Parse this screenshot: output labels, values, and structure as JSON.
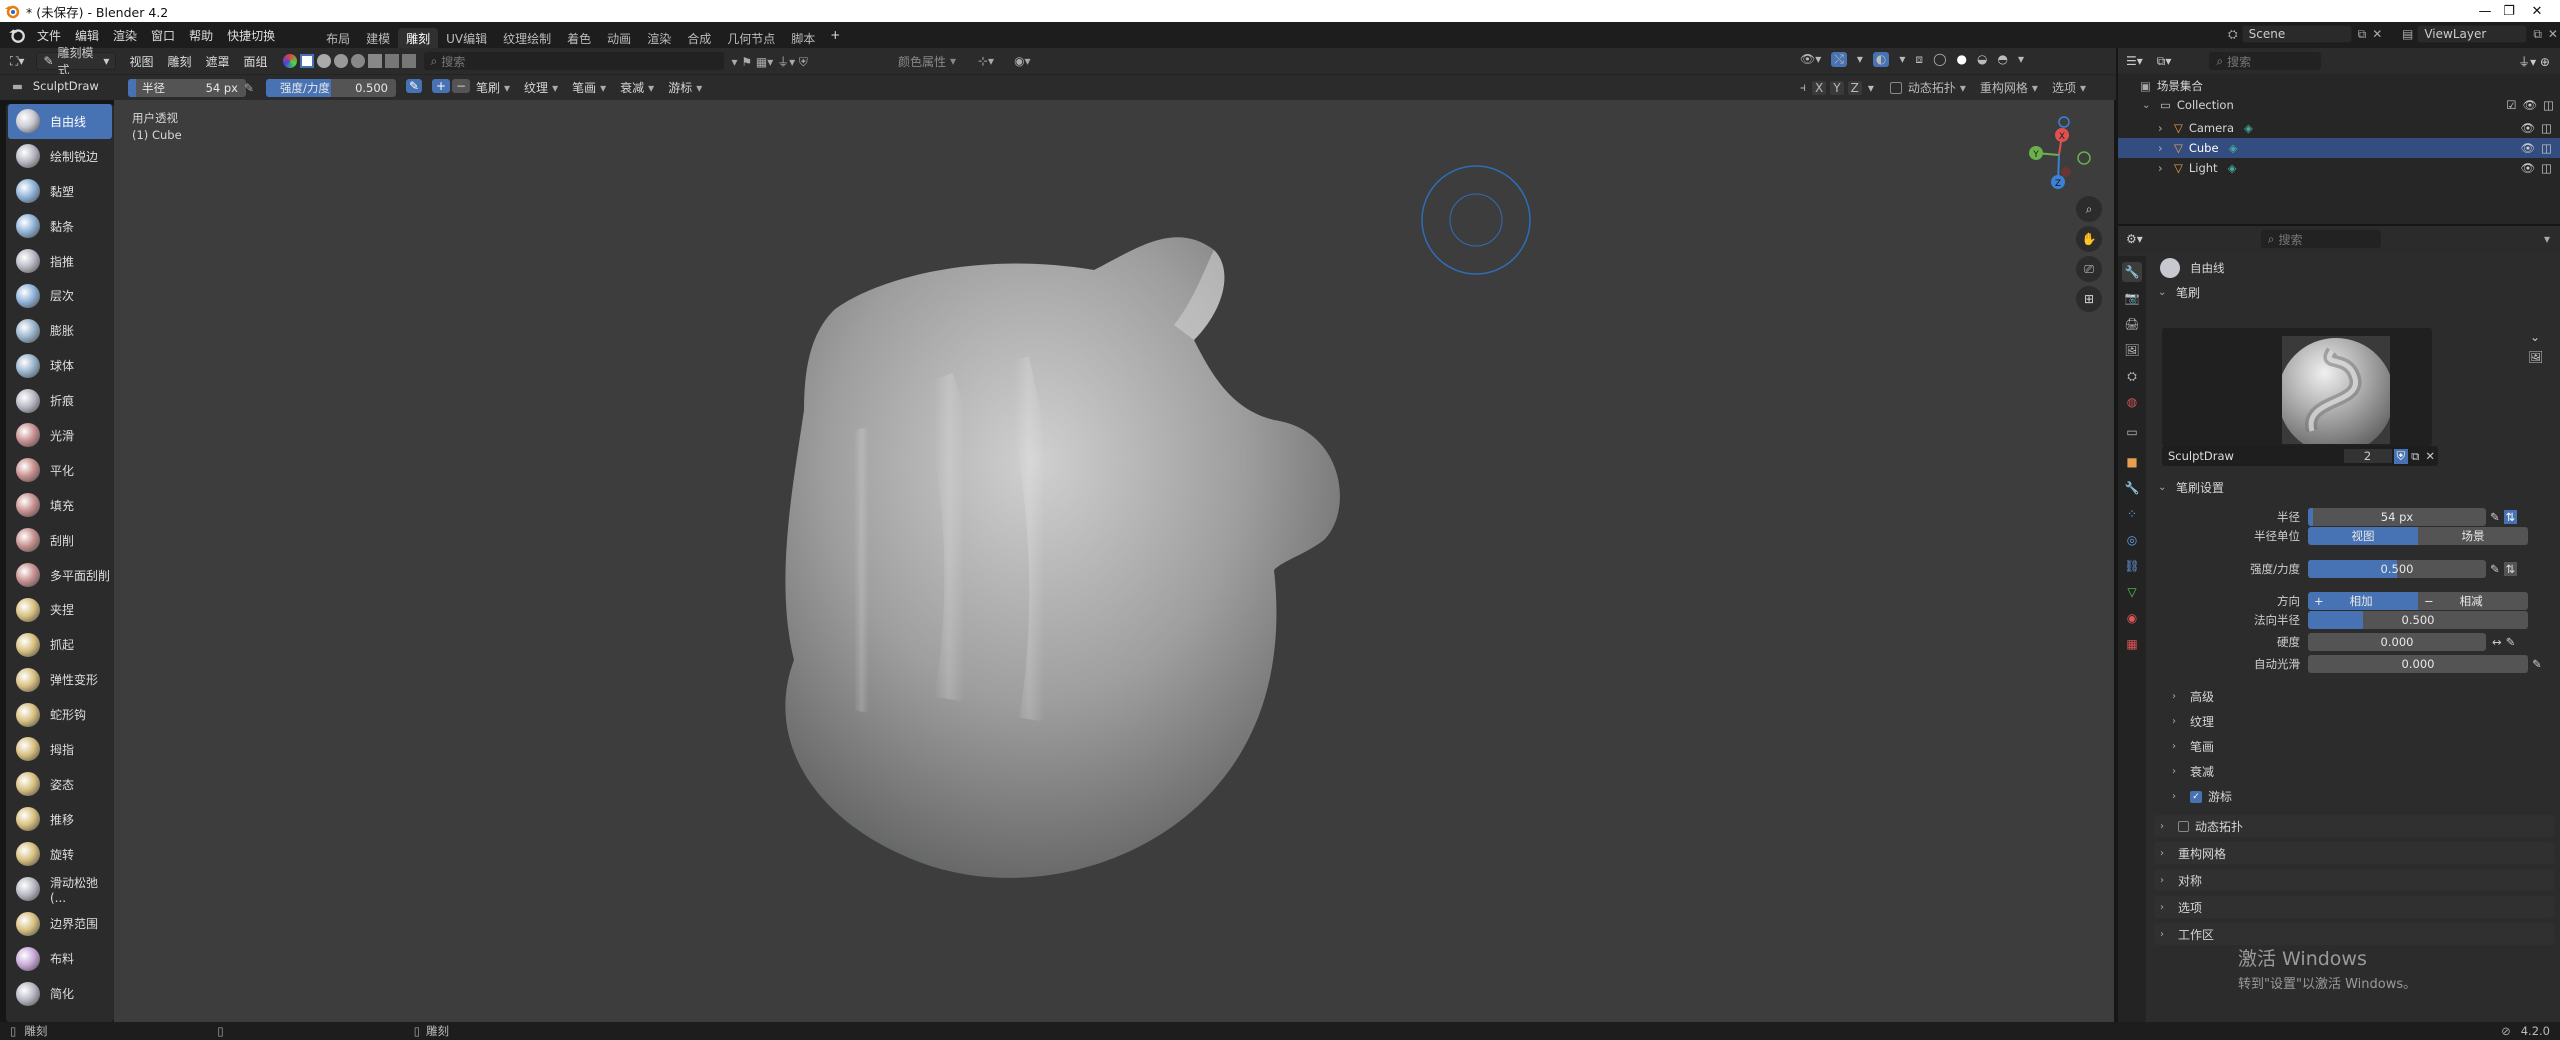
{
  "window": {
    "title": "* (未保存) - Blender 4.2"
  },
  "menus": [
    "文件",
    "编辑",
    "渲染",
    "窗口",
    "帮助",
    "快捷切换"
  ],
  "workspaces": [
    "布局",
    "建模",
    "雕刻",
    "UV编辑",
    "纹理绘制",
    "着色",
    "动画",
    "渲染",
    "合成",
    "几何节点",
    "脚本"
  ],
  "active_workspace": "雕刻",
  "scene": {
    "name": "Scene",
    "viewlayer": "ViewLayer"
  },
  "viewport_header": {
    "mode": "雕刻模式",
    "menus": [
      "视图",
      "雕刻",
      "遮罩",
      "面组"
    ],
    "search_placeholder": "搜索",
    "color_attr": "颜色属性"
  },
  "tool_header": {
    "brush_name": "SculptDraw",
    "radius_label": "半径",
    "radius_value": "54 px",
    "strength_label": "强度/力度",
    "strength_value": "0.500",
    "menus": [
      "笔刷",
      "纹理",
      "笔画",
      "衰减",
      "游标"
    ],
    "right_menus": [
      "动态拓扑",
      "重构网格",
      "选项"
    ],
    "axes": [
      "X",
      "Y",
      "Z"
    ]
  },
  "viewport": {
    "view_name": "用户透视",
    "object_label": "(1) Cube"
  },
  "tools": [
    {
      "label": "自由线",
      "active": true,
      "color": "#c8c8d0"
    },
    {
      "label": "绘制锐边",
      "color": "#b8b8c4"
    },
    {
      "label": "黏塑",
      "color": "#8fb3d8"
    },
    {
      "label": "黏条",
      "color": "#8fb3d8"
    },
    {
      "label": "指推",
      "color": "#b8b8c4"
    },
    {
      "label": "层次",
      "color": "#8fb3d8"
    },
    {
      "label": "膨胀",
      "color": "#9ab4cc"
    },
    {
      "label": "球体",
      "color": "#9ab4cc"
    },
    {
      "label": "折痕",
      "color": "#b8b8c4"
    },
    {
      "label": "光滑",
      "color": "#c89090"
    },
    {
      "label": "平化",
      "color": "#c89090"
    },
    {
      "label": "填充",
      "color": "#c89090"
    },
    {
      "label": "刮削",
      "color": "#c89090"
    },
    {
      "label": "多平面刮削",
      "color": "#c89090"
    },
    {
      "label": "夹捏",
      "color": "#d8c080"
    },
    {
      "label": "抓起",
      "color": "#d8c080"
    },
    {
      "label": "弹性变形",
      "color": "#d8c080"
    },
    {
      "label": "蛇形钩",
      "color": "#d8c080"
    },
    {
      "label": "拇指",
      "color": "#d8c080"
    },
    {
      "label": "姿态",
      "color": "#d8c080"
    },
    {
      "label": "推移",
      "color": "#d8c080"
    },
    {
      "label": "旋转",
      "color": "#d8c080"
    },
    {
      "label": "滑动松弛(...",
      "color": "#b8b8c4"
    },
    {
      "label": "边界范围",
      "color": "#d8c080"
    },
    {
      "label": "布料",
      "color": "#c8a8d8"
    },
    {
      "label": "简化",
      "color": "#b8b8c4"
    }
  ],
  "outliner": {
    "search_placeholder": "搜索",
    "root": "场景集合",
    "collection": "Collection",
    "items": [
      {
        "label": "Camera",
        "color": "#e8a050"
      },
      {
        "label": "Cube",
        "color": "#e8a050",
        "selected": true
      },
      {
        "label": "Light",
        "color": "#e8a050"
      }
    ]
  },
  "properties": {
    "search_placeholder": "搜索",
    "brush_title": "自由线",
    "panel_brush": "笔刷",
    "brush_name": "SculptDraw",
    "brush_users": "2",
    "panel_brush_settings": "笔刷设置",
    "radius": {
      "label": "半径",
      "value": "54 px",
      "fraction": 0.03
    },
    "radius_unit": {
      "label": "半径单位",
      "opt_a": "视图",
      "opt_b": "场景"
    },
    "strength": {
      "label": "强度/力度",
      "value": "0.500",
      "fraction": 0.5
    },
    "direction": {
      "label": "方向",
      "opt_a": "相加",
      "opt_b": "相减"
    },
    "normal_radius": {
      "label": "法向半径",
      "value": "0.500",
      "fraction": 0.25
    },
    "hardness": {
      "label": "硬度",
      "value": "0.000"
    },
    "auto_smooth": {
      "label": "自动光滑",
      "value": "0.000"
    },
    "subpanels": [
      "高级",
      "纹理",
      "笔画",
      "衰减",
      "游标"
    ],
    "sections": [
      "动态拓扑",
      "重构网格",
      "对称",
      "选项",
      "工作区"
    ],
    "watermark_title": "激活 Windows",
    "watermark_sub": "转到\"设置\"以激活 Windows。"
  },
  "statusbar": {
    "left": "雕刻",
    "version": "4.2.0"
  }
}
